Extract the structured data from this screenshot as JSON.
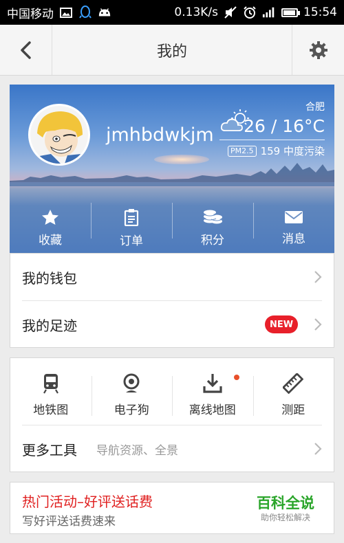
{
  "status_bar": {
    "carrier": "中国移动",
    "speed": "0.13K/s",
    "time": "15:54",
    "battery_level": 0.85,
    "icons": [
      "image-icon",
      "qq-icon",
      "android-icon",
      "mute-icon",
      "alarm-icon",
      "signal-icon",
      "battery-icon"
    ]
  },
  "header": {
    "title": "我的",
    "back_icon": "chevron-left-icon",
    "settings_icon": "gear-icon"
  },
  "profile": {
    "username": "jmhbdwkjm",
    "city": "合肥",
    "temperature": "26 / 16°C",
    "pm_label": "PM2.5",
    "pm_value": "159 中度污染",
    "weather_icon": "partly-cloudy-icon",
    "actions": [
      {
        "label": "收藏",
        "icon": "star-icon"
      },
      {
        "label": "订单",
        "icon": "clipboard-icon"
      },
      {
        "label": "积分",
        "icon": "coins-icon"
      },
      {
        "label": "消息",
        "icon": "envelope-icon"
      }
    ]
  },
  "account": {
    "wallet_label": "我的钱包",
    "footprint_label": "我的足迹",
    "new_badge": "NEW"
  },
  "tools": {
    "items": [
      {
        "label": "地铁图",
        "icon": "subway-icon"
      },
      {
        "label": "电子狗",
        "icon": "camera-icon"
      },
      {
        "label": "离线地图",
        "icon": "download-icon",
        "has_dot": true
      },
      {
        "label": "测距",
        "icon": "ruler-icon"
      }
    ],
    "more_label": "更多工具",
    "more_sub": "导航资源、全景"
  },
  "promo": {
    "title": "热门活动–好评送话费",
    "subtitle": "写好评送话费速来",
    "watermark_name": "百科全说",
    "watermark_sub": "助你轻松解决"
  },
  "colors": {
    "promo_red": "#e02020",
    "badge_red": "#e8202a",
    "watermark_green": "#2aa52a"
  }
}
